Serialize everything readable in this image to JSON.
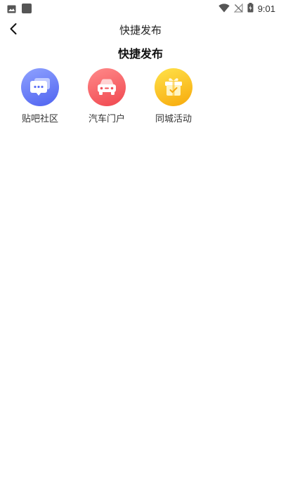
{
  "status_bar": {
    "time": "9:01",
    "icons": [
      "image-icon",
      "app-square-icon",
      "wifi-icon",
      "no-signal-icon",
      "battery-icon"
    ]
  },
  "nav": {
    "title": "快捷发布",
    "back_icon": "chevron-left-icon"
  },
  "section": {
    "title": "快捷发布"
  },
  "items": [
    {
      "label": "贴吧社区",
      "icon": "chat-bubble-icon",
      "color": "#5a6ef5"
    },
    {
      "label": "汽车门户",
      "icon": "car-icon",
      "color": "#f4525a"
    },
    {
      "label": "同城活动",
      "icon": "gift-box-icon",
      "color": "#fbbf1c"
    }
  ]
}
